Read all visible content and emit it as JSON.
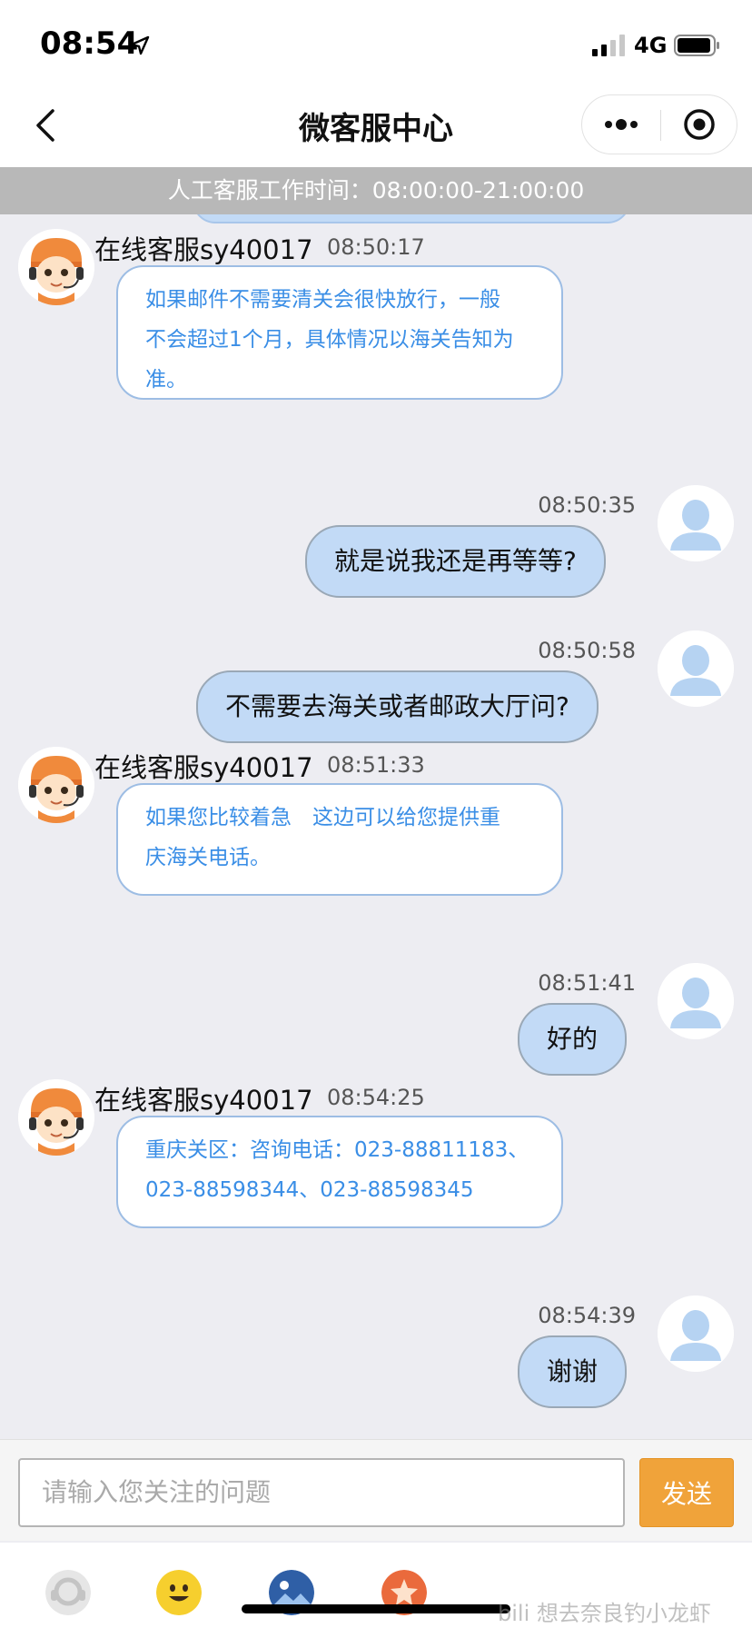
{
  "status_bar": {
    "time": "08:54",
    "network": "4G"
  },
  "nav": {
    "title": "微客服中心"
  },
  "banner": {
    "text": "人工客服工作时间：08:00:00-21:00:00"
  },
  "messages": [
    {
      "from": "agent",
      "name": "在线客服sy40017",
      "time": "08:50:17",
      "lines": [
        "如果邮件不需要清关会很快放行，一般",
        "不会超过1个月，具体情况以海关告知为",
        "准。"
      ]
    },
    {
      "from": "user",
      "time": "08:50:35",
      "text": "就是说我还是再等等?"
    },
    {
      "from": "user",
      "time": "08:50:58",
      "text": "不需要去海关或者邮政大厅问?"
    },
    {
      "from": "agent",
      "name": "在线客服sy40017",
      "time": "08:51:33",
      "lines": [
        "如果您比较着急　这边可以给您提供重",
        "庆海关电话。"
      ]
    },
    {
      "from": "user",
      "time": "08:51:41",
      "text": "好的"
    },
    {
      "from": "agent",
      "name": "在线客服sy40017",
      "time": "08:54:25",
      "lines": [
        "重庆关区：咨询电话：023-88811183、",
        "023-88598344、023-88598345"
      ]
    },
    {
      "from": "user",
      "time": "08:54:39",
      "text": "谢谢"
    }
  ],
  "input": {
    "placeholder": "请输入您关注的问题",
    "send_label": "发送"
  },
  "toolbar": {
    "icons": [
      "service-icon",
      "emoji-icon",
      "image-icon",
      "star-icon"
    ]
  },
  "watermark": {
    "text": "bili 想去奈良钓小龙虾"
  },
  "colors": {
    "accent": "#f0a33a",
    "agent_text": "#3a8ee6",
    "user_bubble": "#c2daf6",
    "banner": "#b8b8b8"
  }
}
